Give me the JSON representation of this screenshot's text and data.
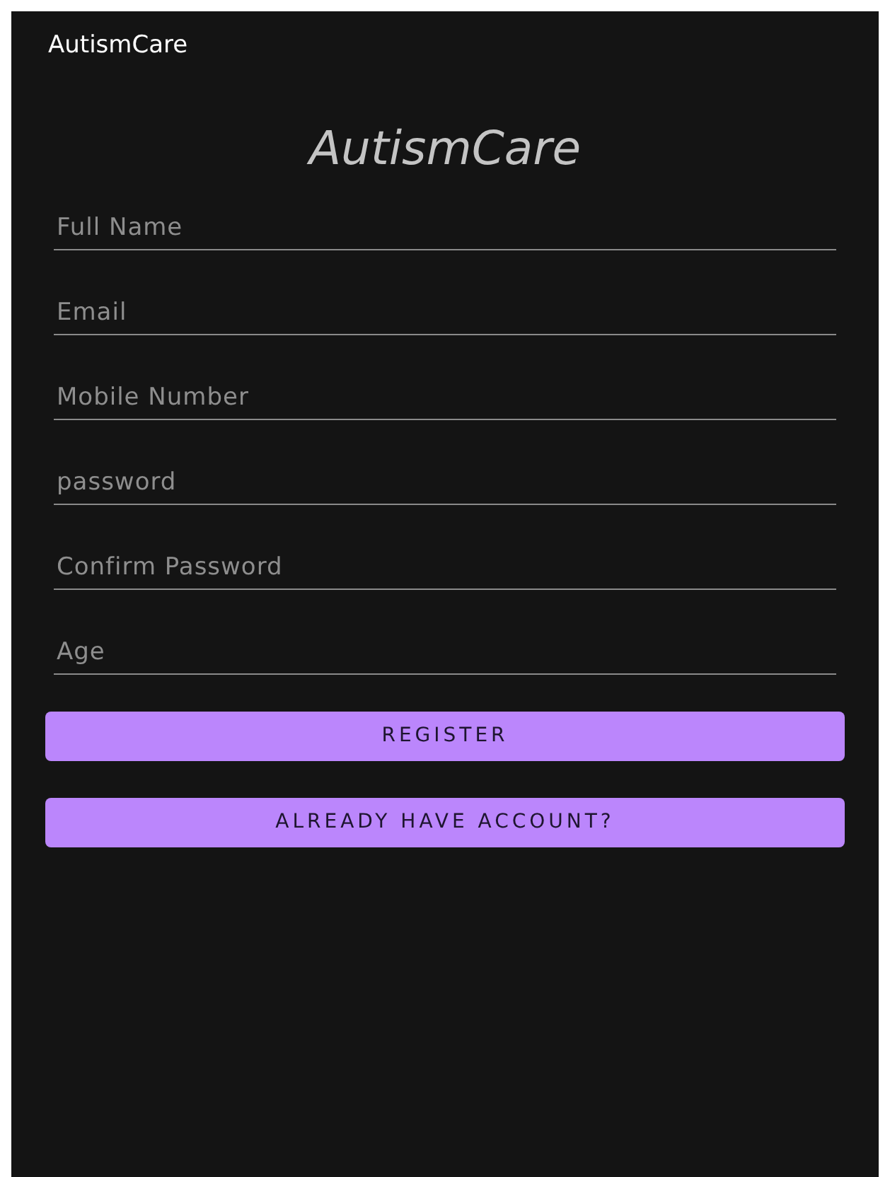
{
  "app_bar": {
    "title": "AutismCare"
  },
  "heading": "AutismCare",
  "fields": [
    {
      "placeholder": "Full Name"
    },
    {
      "placeholder": "Email"
    },
    {
      "placeholder": "Mobile Number"
    },
    {
      "placeholder": "password"
    },
    {
      "placeholder": "Confirm Password"
    },
    {
      "placeholder": "Age"
    }
  ],
  "buttons": [
    "REGISTER",
    "ALREADY HAVE ACCOUNT?"
  ]
}
